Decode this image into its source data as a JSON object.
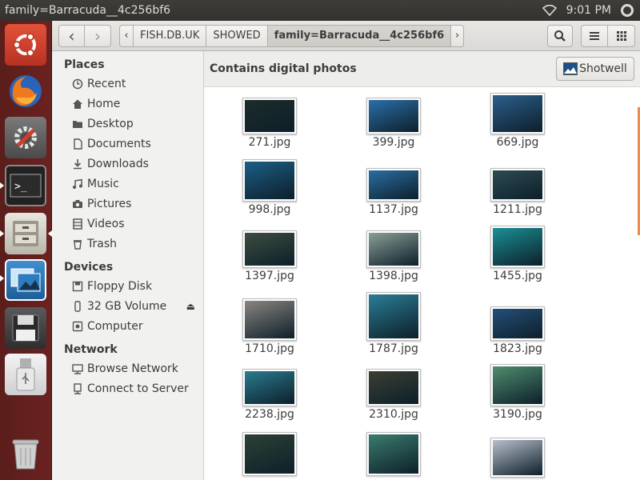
{
  "window_title": "family=Barracuda__4c256bf6",
  "panel": {
    "time": "9:01 PM",
    "icons": [
      "wifi-icon",
      "gear-icon"
    ]
  },
  "launcher": [
    "ubuntu-icon",
    "firefox-icon",
    "settings-icon",
    "terminal-icon",
    "file-manager-icon",
    "shotwell-icon",
    "save-icon",
    "usb-drive-icon",
    "trash-icon"
  ],
  "header": {
    "back": "‹",
    "forward": "›",
    "breadcrumbs": [
      "FISH.DB.UK",
      "SHOWED",
      "family=Barracuda__4c256bf6"
    ],
    "crumb_left": "‹",
    "crumb_right": "›"
  },
  "sidebar": {
    "places_title": "Places",
    "places": [
      {
        "label": "Recent",
        "icon": "clock-icon"
      },
      {
        "label": "Home",
        "icon": "home-icon"
      },
      {
        "label": "Desktop",
        "icon": "folder-icon"
      },
      {
        "label": "Documents",
        "icon": "document-icon"
      },
      {
        "label": "Downloads",
        "icon": "download-icon"
      },
      {
        "label": "Music",
        "icon": "music-icon"
      },
      {
        "label": "Pictures",
        "icon": "camera-icon"
      },
      {
        "label": "Videos",
        "icon": "film-icon"
      },
      {
        "label": "Trash",
        "icon": "trash-icon"
      }
    ],
    "devices_title": "Devices",
    "devices": [
      {
        "label": "Floppy Disk",
        "icon": "floppy-icon"
      },
      {
        "label": "32 GB Volume",
        "icon": "usb-icon"
      },
      {
        "label": "Computer",
        "icon": "computer-icon"
      }
    ],
    "network_title": "Network",
    "network": [
      {
        "label": "Browse Network",
        "icon": "network-icon"
      },
      {
        "label": "Connect to Server",
        "icon": "server-icon"
      }
    ]
  },
  "infobar": {
    "text": "Contains digital photos",
    "button": "Shotwell"
  },
  "files": [
    {
      "name": "271.jpg",
      "color": "#1d2b2a"
    },
    {
      "name": "399.jpg",
      "color": "#2a6fa8"
    },
    {
      "name": "669.jpg",
      "color": "#2c5f8c"
    },
    {
      "name": "998.jpg",
      "color": "#1c5e86"
    },
    {
      "name": "1137.jpg",
      "color": "#2a6ea3"
    },
    {
      "name": "1211.jpg",
      "color": "#2d4b52"
    },
    {
      "name": "1397.jpg",
      "color": "#3d4d40"
    },
    {
      "name": "1398.jpg",
      "color": "#8a9f96"
    },
    {
      "name": "1455.jpg",
      "color": "#1b8f95"
    },
    {
      "name": "1710.jpg",
      "color": "#8a8580"
    },
    {
      "name": "1787.jpg",
      "color": "#2b7d95"
    },
    {
      "name": "1823.jpg",
      "color": "#244f78"
    },
    {
      "name": "2238.jpg",
      "color": "#2a7b8f"
    },
    {
      "name": "2310.jpg",
      "color": "#3b3f33"
    },
    {
      "name": "3190.jpg",
      "color": "#4f8d6e"
    },
    {
      "name": "",
      "color": "#2d4135"
    },
    {
      "name": "",
      "color": "#3b7c6e"
    },
    {
      "name": "",
      "color": "#b7bfcb"
    }
  ]
}
